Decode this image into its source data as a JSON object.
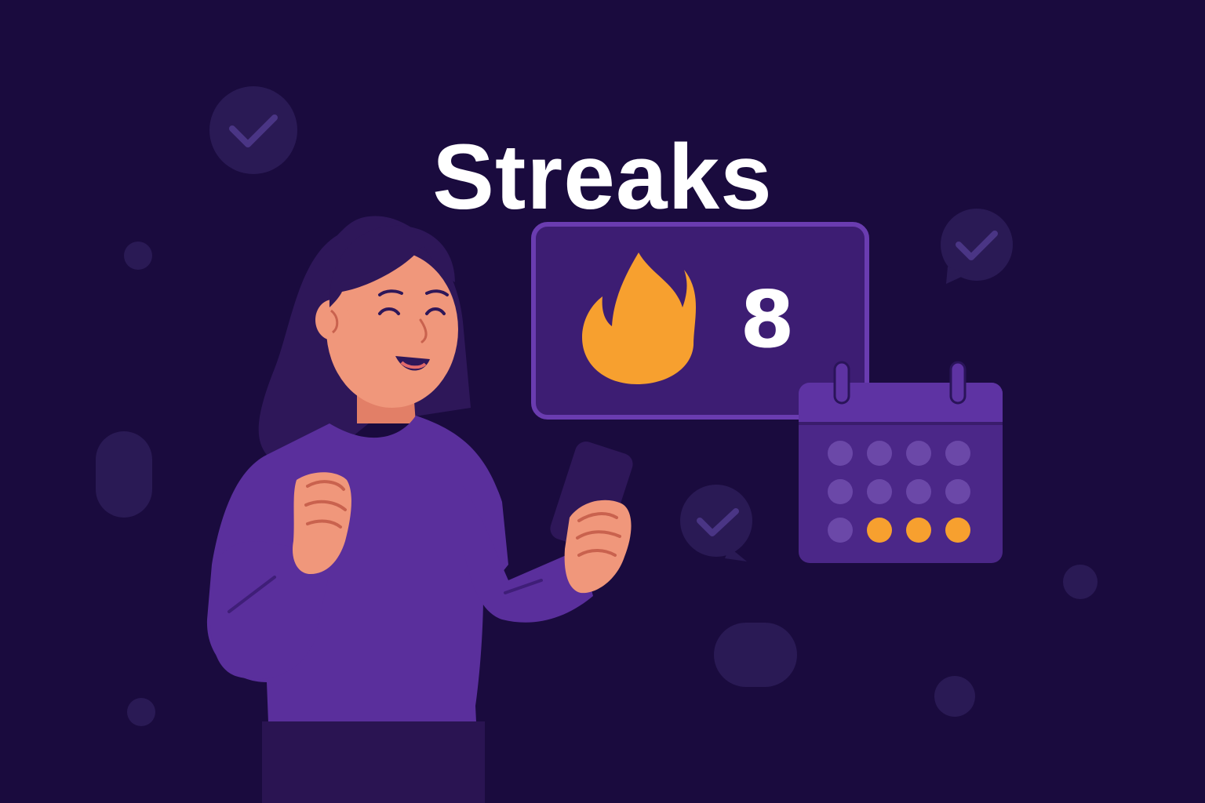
{
  "title": "Streaks",
  "streak": {
    "count": "8",
    "icon": "flame-icon"
  },
  "calendar": {
    "icon": "calendar-icon",
    "rows": [
      [
        false,
        false,
        false,
        false
      ],
      [
        false,
        false,
        false,
        false
      ],
      [
        false,
        true,
        true,
        true
      ]
    ]
  },
  "colors": {
    "background": "#1a0b3e",
    "card": "#3d1d73",
    "card_border": "#6a3cb0",
    "flame": "#f7a02f",
    "accent_dot": "#f7a02f",
    "shirt": "#5a2f9c",
    "skin": "#f0977b"
  }
}
